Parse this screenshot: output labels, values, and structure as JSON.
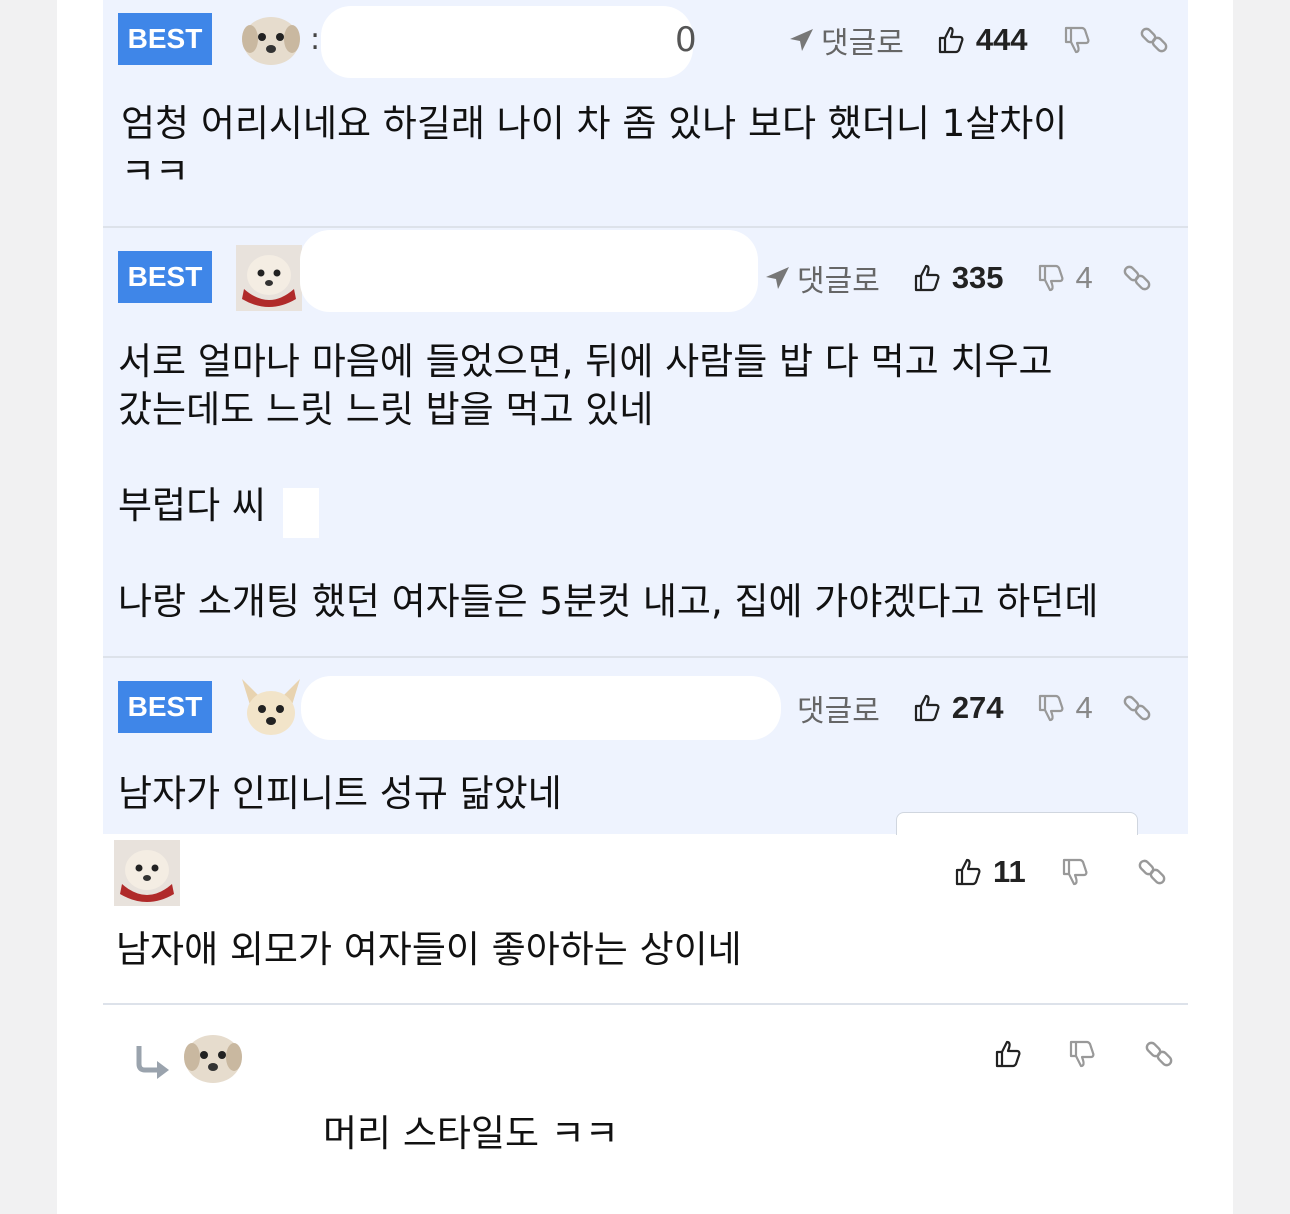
{
  "comments": [
    {
      "badge": "BEST",
      "avatar": "puppy-avatar",
      "author_visible": ":",
      "date_fragment": "0",
      "reply_label": "댓글로",
      "likes": "444",
      "dislikes": "",
      "text": "엄청 어리시네요 하길래 나이 차 좀 있나 보다 했더니 1살차이\nㅋㅋ"
    },
    {
      "badge": "BEST",
      "avatar": "maltese-red-collar-avatar",
      "reply_label": "댓글로",
      "likes": "335",
      "dislikes": "4",
      "text": "서로 얼마나 마음에 들었으면, 뒤에 사람들 밥 다 먹고 치우고\n갔는데도 느릿 느릿 밥을 먹고 있네\n\n부럽다 씨\n\n나랑 소개팅 했던 여자들은 5분컷 내고, 집에 가야겠다고 하던데"
    },
    {
      "badge": "BEST",
      "avatar": "chihuahua-avatar",
      "reply_label": "댓글로",
      "likes": "274",
      "dislikes": "4",
      "text": "남자가 인피니트 성규 닮았네"
    },
    {
      "avatar": "maltese-red-collar-avatar",
      "likes": "11",
      "dislikes": "",
      "text": "남자애 외모가 여자들이 좋아하는 상이네"
    },
    {
      "avatar": "puppy-avatar",
      "is_reply": true,
      "likes": "",
      "dislikes": "",
      "text": "머리 스타일도 ㅋㅋ"
    }
  ],
  "colors": {
    "best_badge": "#3f86e8",
    "best_background": "#eef3fe",
    "reply_arrow": "#9aa3ad"
  }
}
